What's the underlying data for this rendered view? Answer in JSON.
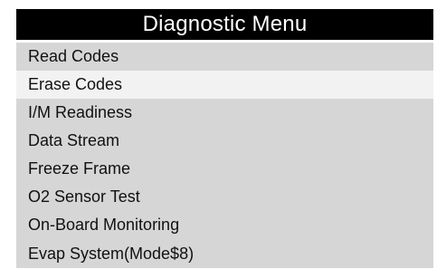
{
  "header": {
    "title": "Diagnostic Menu"
  },
  "menu": {
    "selected_index": 1,
    "items": [
      {
        "label": "Read Codes"
      },
      {
        "label": "Erase Codes"
      },
      {
        "label": "I/M Readiness"
      },
      {
        "label": "Data Stream"
      },
      {
        "label": "Freeze Frame"
      },
      {
        "label": "O2 Sensor Test"
      },
      {
        "label": "On-Board Monitoring"
      },
      {
        "label": "Evap System(Mode$8)"
      }
    ]
  },
  "colors": {
    "title_background": "#000000",
    "title_text": "#ffffff",
    "item_background": "#d6d6d6",
    "selected_item_background": "#f2f2f2",
    "item_text": "#111111"
  }
}
